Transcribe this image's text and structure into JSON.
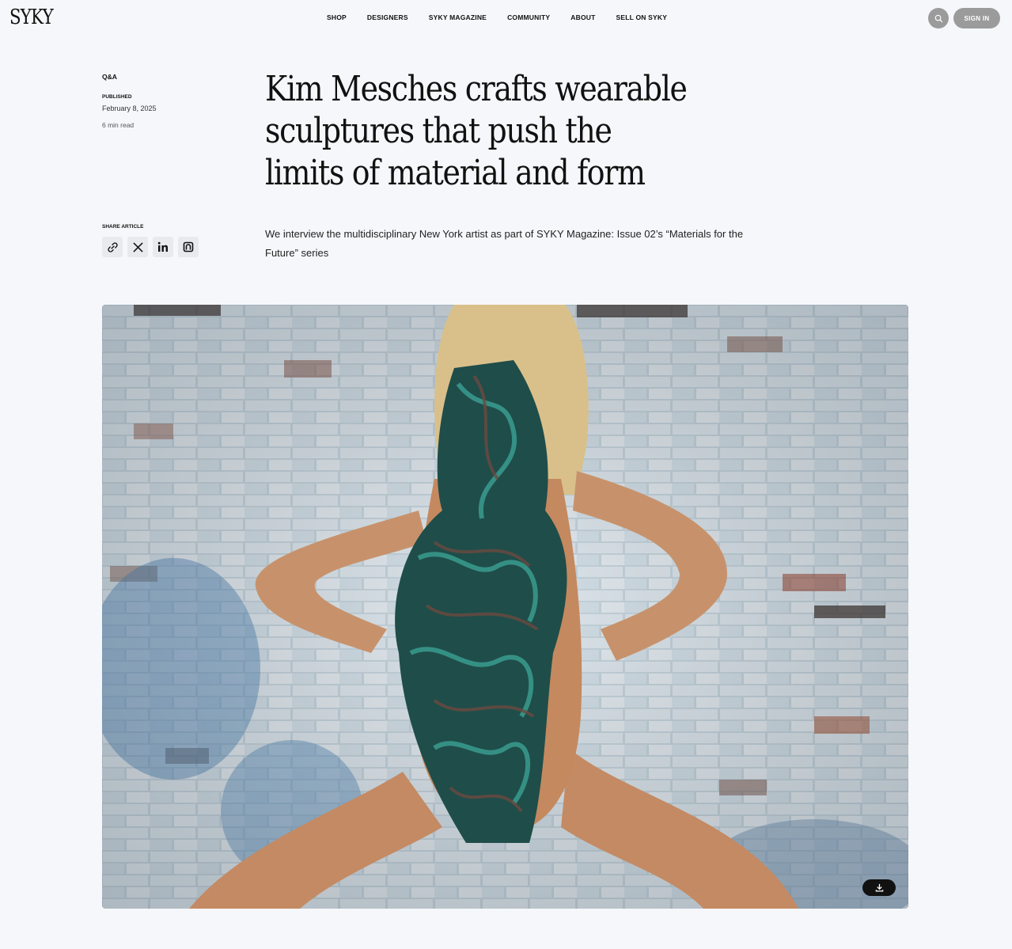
{
  "header": {
    "logo": "SYKY",
    "nav": [
      "Shop",
      "Designers",
      "SYKY Magazine",
      "Community",
      "About",
      "Sell on SYKY"
    ],
    "sign_in": "SIGN IN",
    "search_icon": "search-icon"
  },
  "article": {
    "category": "Q&A",
    "published_label": "PUBLISHED",
    "published_date": "February 8, 2025",
    "read_time": "6 min read",
    "title": "Kim Mesches crafts wearable sculptures that push the limits of material and form",
    "share_label": "SHARE ARTICLE",
    "share_icons": [
      "link-icon",
      "x-icon",
      "linkedin-icon",
      "substack-icon"
    ],
    "subtitle": "We interview the multidisciplinary New York artist as part of SYKY Magazine: Issue 02’s “Materials for the Future” series"
  },
  "hero": {
    "download_icon": "download-icon"
  },
  "colors": {
    "background": "#f6f7fa",
    "button_gray": "#9b9b9b",
    "text": "#111111",
    "share_bg": "#e9eaee"
  }
}
